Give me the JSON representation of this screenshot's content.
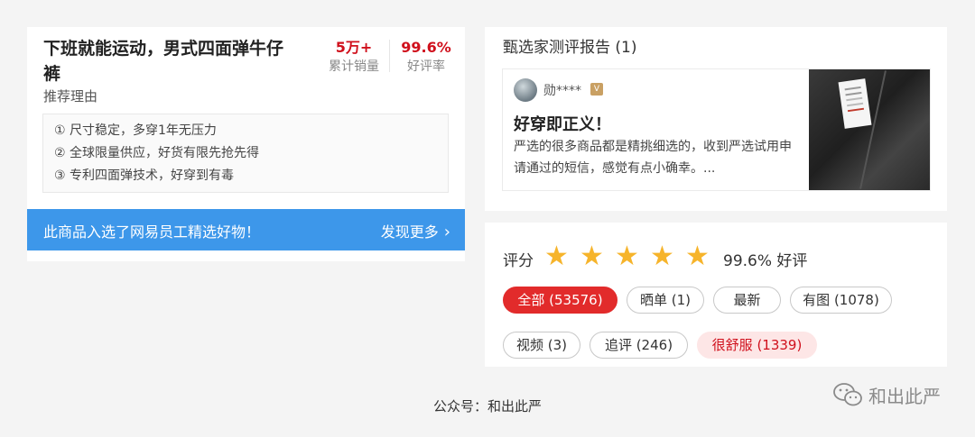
{
  "product": {
    "title": "下班就能运动，男式四面弹牛仔裤",
    "sales_value": "5万+",
    "sales_label": "累计销量",
    "rating_value": "99.6%",
    "rating_label": "好评率",
    "reason_label": "推荐理由",
    "reasons": [
      "① 尺寸稳定，多穿1年无压力",
      "② 全球限量供应，好货有限先抢先得",
      "③ 专利四面弹技术，好穿到有毒"
    ],
    "banner_text": "此商品入选了网易员工精选好物！",
    "banner_more": "发现更多",
    "banner_icon": "chevron-right-icon"
  },
  "report": {
    "title": "甄选家测评报告 (1)",
    "username": "勋****",
    "badge": "V",
    "card_title": "好穿即正义！",
    "card_text": "严选的很多商品都是精挑细选的，收到严选试用申请通过的短信，感觉有点小确幸。..."
  },
  "rating": {
    "label": "评分",
    "stars": 5,
    "value": "99.6% 好评",
    "star_color": "#f6b42b",
    "tags": [
      {
        "label": "全部 (53576)",
        "state": "active"
      },
      {
        "label": "晒单 (1)",
        "state": "normal"
      },
      {
        "label": "最新",
        "state": "normal"
      },
      {
        "label": "有图 (1078)",
        "state": "normal"
      },
      {
        "label": "视频 (3)",
        "state": "normal"
      },
      {
        "label": "追评 (246)",
        "state": "normal"
      },
      {
        "label": "很舒服 (1339)",
        "state": "pink"
      }
    ]
  },
  "footer": {
    "caption": "公众号：和出此严",
    "watermark": "和出此严",
    "watermark_icon": "wechat-icon"
  },
  "colors": {
    "accent_red": "#d0101c",
    "banner_blue": "#3d97ea",
    "active_tag": "#e22b2b"
  }
}
